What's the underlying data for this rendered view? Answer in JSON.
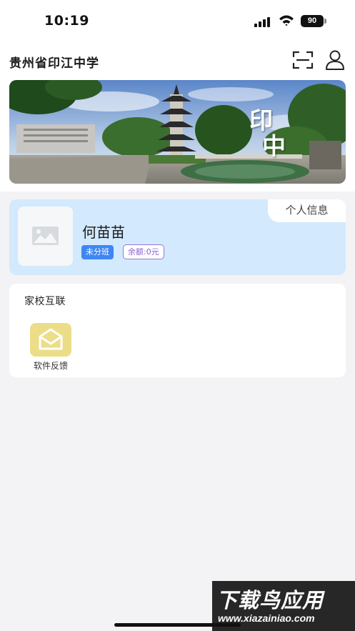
{
  "status_bar": {
    "time": "10:19",
    "battery": "90",
    "icons": [
      "signal-icon",
      "wifi-icon",
      "battery-icon"
    ]
  },
  "header": {
    "title": "贵州省印江中学",
    "actions": [
      {
        "icon": "scan-icon"
      },
      {
        "icon": "user-icon"
      }
    ]
  },
  "banner": {
    "caption": "印中",
    "caption_chars": [
      "印",
      "中"
    ]
  },
  "profile": {
    "tab_label": "个人信息",
    "name": "何苗苗",
    "class_badge": "未分班",
    "balance_badge": "余额:0元",
    "avatar_icon": "image-placeholder-icon",
    "colors": {
      "card": "#d3e9fd",
      "class_badge": "#3f86f4",
      "balance_border": "#9b74d8"
    }
  },
  "home_school": {
    "title": "家校互联",
    "items": [
      {
        "label": "软件反馈",
        "icon": "mail-icon",
        "color": "#ecdd88"
      }
    ]
  },
  "watermark": {
    "title": "下载鸟应用",
    "url": "www.xiazainiao.com"
  }
}
